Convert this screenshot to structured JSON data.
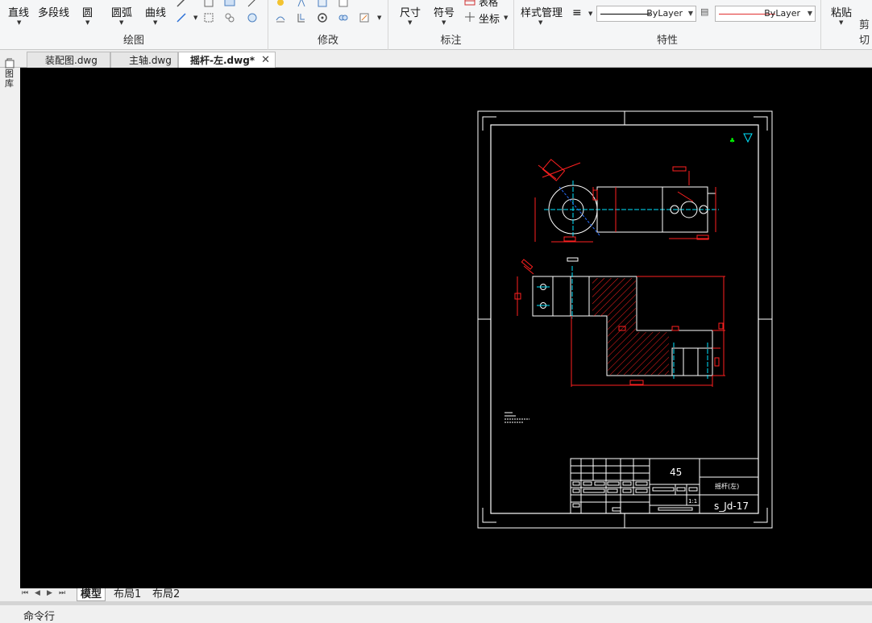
{
  "ribbon": {
    "draw": {
      "line": "直线",
      "polyline": "多段线",
      "circle": "圆",
      "arc": "圆弧",
      "curve": "曲线",
      "title": "绘图"
    },
    "modify": {
      "title": "修改"
    },
    "annotate": {
      "dimension": "尺寸",
      "symbol": "符号",
      "table": "表格",
      "coordinate": "坐标",
      "title": "标注"
    },
    "properties": {
      "style_manager": "样式管理",
      "linetype": "ByLayer",
      "color": "ByLayer",
      "title": "特性"
    },
    "clipboard": {
      "paste": "粘贴",
      "title": "剪切"
    },
    "colors": {
      "linetype_line": "#000000",
      "color_line": "#e03030"
    }
  },
  "tabs": [
    {
      "label": "装配图.dwg"
    },
    {
      "label": "主轴.dwg"
    },
    {
      "label": "摇杆-左.dwg*"
    }
  ],
  "side_panel": {
    "label": "图库"
  },
  "drawing": {
    "material": "45",
    "part_name": "摇杆(左)",
    "drawing_number": "s_Jd-17",
    "scale": "1:1",
    "colors": {
      "background": "#000000",
      "frame": "#ffffff",
      "dimension": "#ff2020",
      "centerline": "#00e5ff",
      "hatch": "#ff2020",
      "marker_green": "#00ff00",
      "marker_cyan": "#00e5ff"
    }
  },
  "layout_tabs": [
    {
      "label": "模型"
    },
    {
      "label": "布局1"
    },
    {
      "label": "布局2"
    }
  ],
  "command_line": {
    "label": "命令行"
  }
}
